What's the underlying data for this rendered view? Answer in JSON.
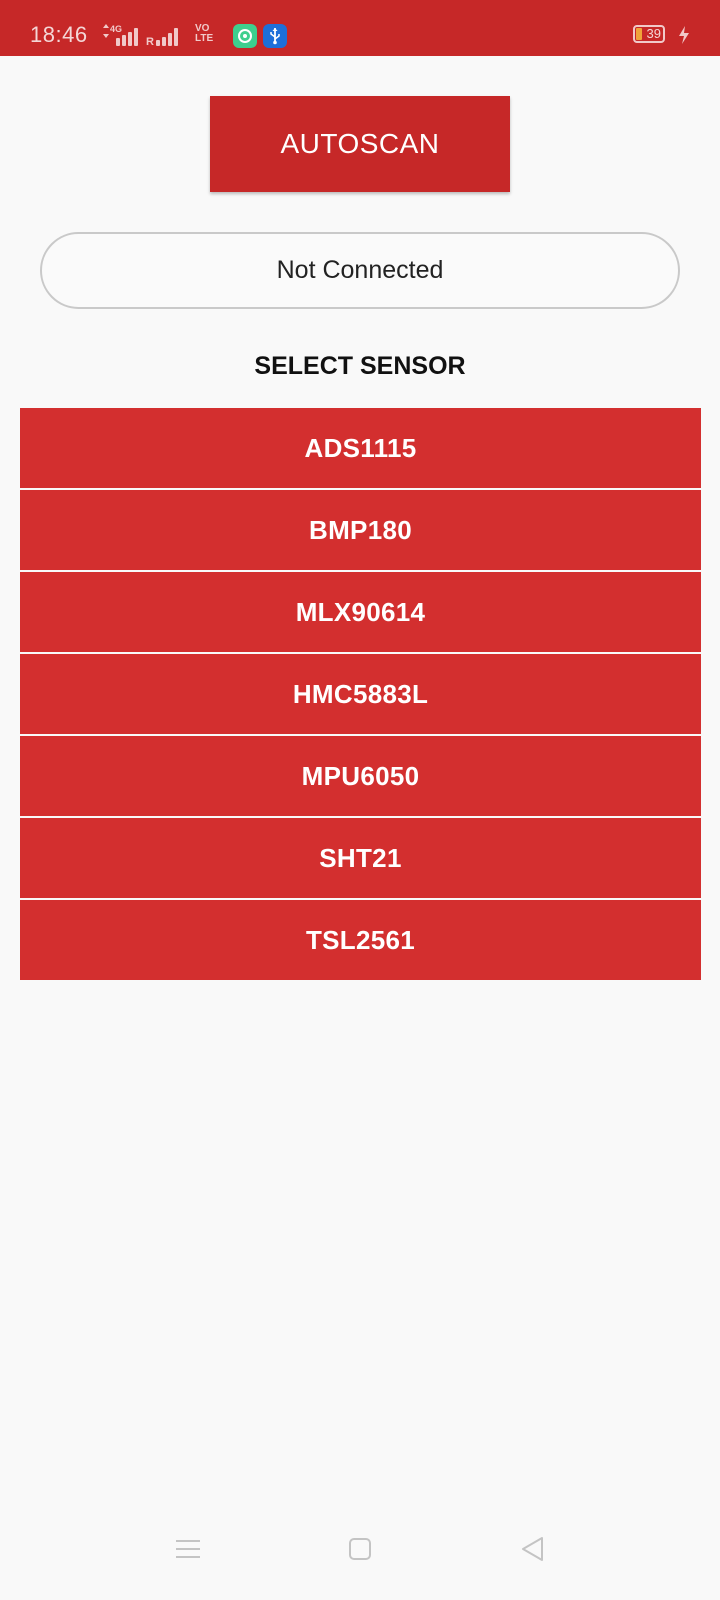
{
  "status_bar": {
    "time": "18:46",
    "network_type": "4G",
    "roaming": "R",
    "volte_top": "VO",
    "volte_bottom": "LTE",
    "battery_level": "39",
    "color": "#c62828"
  },
  "autoscan_button": {
    "label": "AUTOSCAN"
  },
  "connection": {
    "status": "Not Connected"
  },
  "sensor_section": {
    "title": "SELECT SENSOR",
    "sensors": [
      {
        "label": "ADS1115"
      },
      {
        "label": "BMP180"
      },
      {
        "label": "MLX90614"
      },
      {
        "label": "HMC5883L"
      },
      {
        "label": "MPU6050"
      },
      {
        "label": "SHT21"
      },
      {
        "label": "TSL2561"
      }
    ]
  },
  "nav_bar": {
    "icons": [
      "menu-icon",
      "home-square-icon",
      "back-triangle-icon"
    ]
  },
  "colors": {
    "primary": "#c62828",
    "sensor_button": "#d32f2f",
    "background": "#f9f9f9"
  }
}
